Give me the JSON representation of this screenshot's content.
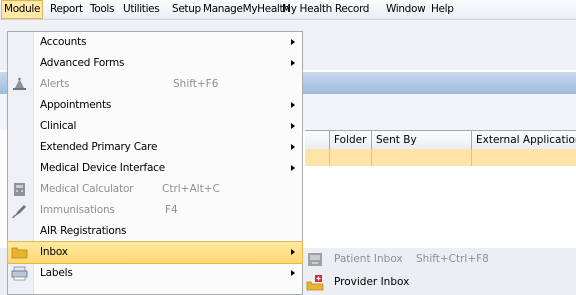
{
  "menubar": {
    "items": [
      "Module",
      "Report",
      "Tools",
      "Utilities",
      "Setup",
      "ManageMyHealth",
      "My Health Record",
      "Window",
      "Help"
    ],
    "active": "Module"
  },
  "grid": {
    "columns": [
      "Folder",
      "Sent By",
      "External Application"
    ]
  },
  "module_menu": {
    "items": [
      {
        "label": "Accounts",
        "submenu": true,
        "enabled": true,
        "icon": null
      },
      {
        "label": "Advanced Forms",
        "submenu": true,
        "enabled": true,
        "icon": null
      },
      {
        "label": "Alerts",
        "shortcut": "Shift+F6",
        "submenu": false,
        "enabled": false,
        "icon": "alert-bell-icon"
      },
      {
        "label": "Appointments",
        "submenu": true,
        "enabled": true,
        "icon": null
      },
      {
        "label": "Clinical",
        "submenu": true,
        "enabled": true,
        "icon": null
      },
      {
        "label": "Extended Primary Care",
        "submenu": true,
        "enabled": true,
        "icon": null
      },
      {
        "label": "Medical Device Interface",
        "submenu": true,
        "enabled": true,
        "icon": null
      },
      {
        "label": "Medical Calculator",
        "shortcut": "Ctrl+Alt+C",
        "submenu": false,
        "enabled": false,
        "icon": "calculator-icon"
      },
      {
        "label": "Immunisations",
        "shortcut": "F4",
        "submenu": false,
        "enabled": false,
        "icon": "syringe-icon"
      },
      {
        "label": "AIR Registrations",
        "submenu": false,
        "enabled": true,
        "icon": null
      },
      {
        "label": "Inbox",
        "submenu": true,
        "enabled": true,
        "highlighted": true,
        "icon": "inbox-folder-icon"
      },
      {
        "label": "Labels",
        "submenu": true,
        "enabled": true,
        "icon": "labels-icon"
      }
    ]
  },
  "inbox_submenu": {
    "items": [
      {
        "label": "Patient Inbox",
        "shortcut": "Shift+Ctrl+F8",
        "enabled": false,
        "icon": "patient-inbox-icon"
      },
      {
        "label": "Provider Inbox",
        "enabled": true,
        "icon": "provider-inbox-icon"
      }
    ]
  },
  "colors": {
    "highlight": "#ffd871",
    "highlight_border": "#e5b84d",
    "disabled_text": "#8f8f8f"
  }
}
